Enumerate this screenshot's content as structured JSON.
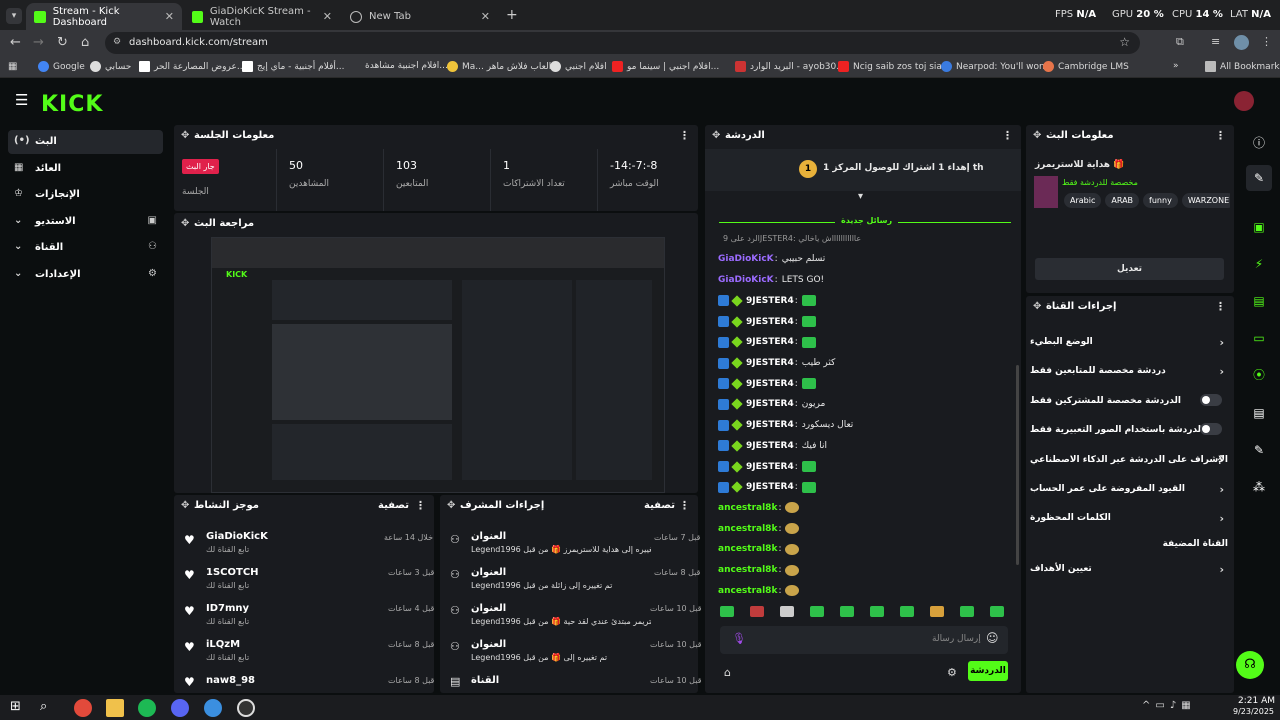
{
  "browser": {
    "tabs": [
      {
        "title": "Stream - Kick Dashboard",
        "active": true
      },
      {
        "title": "GiaDioKicK Stream - Watch",
        "active": false
      },
      {
        "title": "New Tab",
        "active": false
      }
    ],
    "url": "dashboard.kick.com/stream",
    "stats": {
      "fps_label": "FPS",
      "fps": "N/A",
      "gpu_label": "GPU",
      "gpu": "20 %",
      "cpu_label": "CPU",
      "cpu": "14 %",
      "lat_label": "LAT",
      "lat": "N/A"
    },
    "bookmarks": [
      "Google",
      "حسابي",
      "عروض المصارعة الحر...",
      "أفلام أجنبية - ماي إيج...",
      "افلام اجنبية مشاهدة...",
      "Ma... العاب فلاش ماهر",
      "افلام اجنبي",
      "افلام اجنبي | سينما مو...",
      "البريد الوارد - ayob30...",
      "Ncig saib zos toj sia...",
      "Nearpod: You'll won...",
      "Cambridge LMS"
    ],
    "all_bookmarks": "All Bookmarks"
  },
  "sidebar": {
    "logo": "KICK",
    "items": [
      {
        "label": "البث"
      },
      {
        "label": "العائد"
      },
      {
        "label": "الإنجازات"
      },
      {
        "label": "الاستديو"
      },
      {
        "label": "القناة"
      },
      {
        "label": "الإعدادات"
      }
    ]
  },
  "session": {
    "title": "معلومات الجلسة",
    "live_badge": "جار البث",
    "session_label": "الجلسة",
    "stats": [
      {
        "value": "50",
        "label": "المشاهدين"
      },
      {
        "value": "103",
        "label": "المتابعين"
      },
      {
        "value": "1",
        "label": "تعداد الاشتراكات"
      },
      {
        "value": "-14:-7:-8",
        "label": "الوقت مباشر"
      }
    ]
  },
  "preview": {
    "title": "مراجعة البث"
  },
  "activity": {
    "title": "موجز النشاط",
    "filter": "تصفية",
    "items": [
      {
        "name": "GiaDioKicK",
        "sub": "تابع القناة لك",
        "time": "خلال 14 ساعة"
      },
      {
        "name": "1SCOTCH",
        "sub": "تابع القناة لك",
        "time": "قبل 3 ساعات"
      },
      {
        "name": "ID7mny",
        "sub": "تابع القناة لك",
        "time": "قبل 4 ساعات"
      },
      {
        "name": "iLQzM",
        "sub": "تابع القناة لك",
        "time": "قبل 8 ساعات"
      },
      {
        "name": "naw8_98",
        "sub": "",
        "time": "قبل 8 ساعات"
      }
    ]
  },
  "mod": {
    "title": "إجراءات المشرف",
    "filter": "تصفية",
    "items": [
      {
        "head": "العنوان",
        "sub": "Legend1996 تم تغييره إلى هداية للاستريمرز 🎁 من قبل",
        "time": "قبل 7 ساعات"
      },
      {
        "head": "العنوان",
        "sub": "Legend1996 تم تغييره إلى زائلة من قبل",
        "time": "قبل 8 ساعات"
      },
      {
        "head": "العنوان",
        "sub": "Legend1996 تم تغييره إلى لوقت استريمر مبتدئ عندي لقد حية 🎁 من قبل",
        "time": "قبل 10 ساعات"
      },
      {
        "head": "العنوان",
        "sub": "Legend1996 تم تغييره إلى 🎁 من قبل",
        "time": "قبل 10 ساعات"
      },
      {
        "head": "القناة",
        "sub": "",
        "time": "قبل 10 ساعات"
      }
    ]
  },
  "chat": {
    "title": "الدردشة",
    "goal": "إهداء 1 اشتراك للوصول المركز 1 th",
    "goal_rank": "1",
    "new_messages": "رسائل جديدة",
    "reply_line": "الرد على 9JESTER4: عاااااااااااش ياخالي",
    "messages": [
      {
        "user": "GiaDioKicK",
        "text": "تسلم حبيبي",
        "color": "#9b6bff",
        "badge": false
      },
      {
        "user": "GiaDioKicK",
        "text": "LETS GO!",
        "color": "#9b6bff",
        "badge": false
      },
      {
        "user": "9JESTER4",
        "text": "",
        "color": "#ffffff",
        "badge": true,
        "emote": true
      },
      {
        "user": "9JESTER4",
        "text": "",
        "color": "#ffffff",
        "badge": true,
        "emote": true
      },
      {
        "user": "9JESTER4",
        "text": "",
        "color": "#ffffff",
        "badge": true,
        "emote": true
      },
      {
        "user": "9JESTER4",
        "text": "كثر طيب",
        "color": "#ffffff",
        "badge": true,
        "emote": false
      },
      {
        "user": "9JESTER4",
        "text": "",
        "color": "#ffffff",
        "badge": true,
        "emote": true
      },
      {
        "user": "9JESTER4",
        "text": "مريون",
        "color": "#ffffff",
        "badge": true,
        "emote": false
      },
      {
        "user": "9JESTER4",
        "text": "تعال ديسكورد",
        "color": "#ffffff",
        "badge": true,
        "emote": false
      },
      {
        "user": "9JESTER4",
        "text": "انا فيك",
        "color": "#ffffff",
        "badge": true,
        "emote": false
      },
      {
        "user": "9JESTER4",
        "text": "",
        "color": "#ffffff",
        "badge": true,
        "emote": true
      },
      {
        "user": "9JESTER4",
        "text": "",
        "color": "#ffffff",
        "badge": true,
        "emote": true
      },
      {
        "user": "ancestral8k",
        "text": "",
        "color": "#53fc18",
        "badge": false,
        "emote": true
      },
      {
        "user": "ancestral8k",
        "text": "",
        "color": "#53fc18",
        "badge": false,
        "emote": true
      },
      {
        "user": "ancestral8k",
        "text": "",
        "color": "#53fc18",
        "badge": false,
        "emote": true
      },
      {
        "user": "ancestral8k",
        "text": "",
        "color": "#53fc18",
        "badge": false,
        "emote": true
      },
      {
        "user": "ancestral8k",
        "text": "",
        "color": "#53fc18",
        "badge": false,
        "emote": true
      }
    ],
    "input_placeholder": "إرسال رسالة",
    "send_label": "الدردشة"
  },
  "stream_info": {
    "title": "معلومات البث",
    "stream_title": "هداية للاستريمرز 🎁",
    "category": "مخصصة للدردشة فقط",
    "tags": [
      "Arabic",
      "ARAB",
      "funny",
      "WARZONE"
    ],
    "edit_label": "تعديل"
  },
  "channel_actions": {
    "title": "إجراءات القناة",
    "rows": [
      {
        "label": "الوضع البطيء",
        "type": "chevron"
      },
      {
        "label": "دردشة مخصصة للمتابعين فقط",
        "type": "chevron"
      },
      {
        "label": "الدردشة مخصصة للمشتركين فقط",
        "type": "toggle"
      },
      {
        "label": "الدردشة باستخدام الصور التعبيرية فقط",
        "type": "toggle"
      },
      {
        "label": "الإشراف على الدردشة عبر الذكاء الاصطناعي",
        "type": "ext"
      },
      {
        "label": "القيود المفروضة على عمر الحساب",
        "type": "chevron"
      },
      {
        "label": "الكلمات المحظورة",
        "type": "chevron"
      },
      {
        "label": "القناة المضيفة",
        "type": "none"
      },
      {
        "label": "تعيين الأهداف",
        "type": "chevron"
      }
    ]
  },
  "taskbar": {
    "time": "2:21 AM",
    "date": "9/23/2025"
  }
}
